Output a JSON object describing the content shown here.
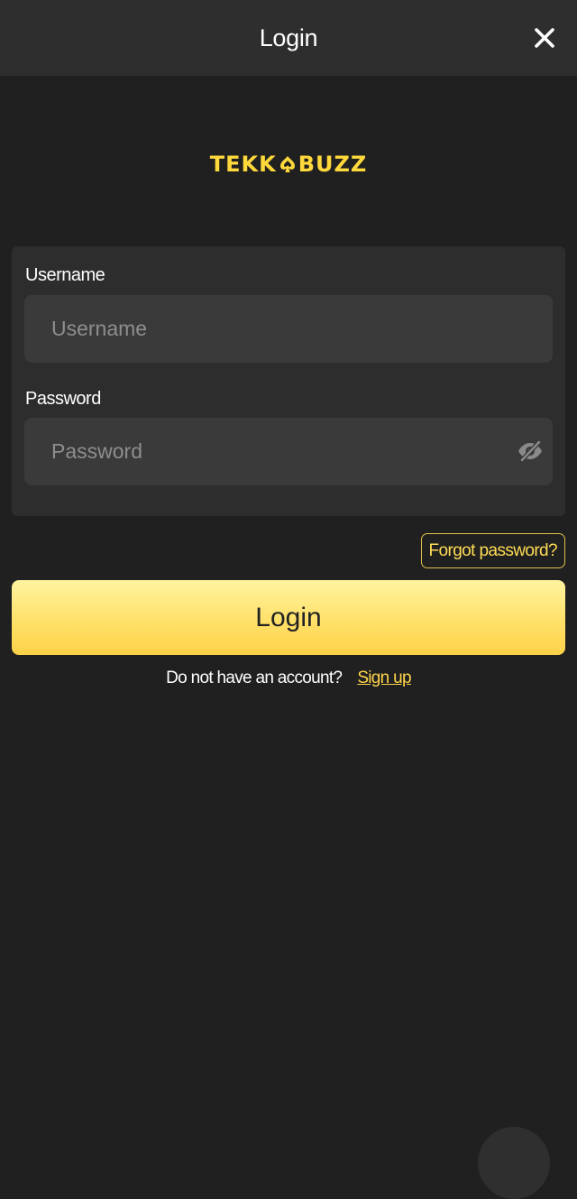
{
  "header": {
    "title": "Login",
    "close_icon": "close-icon"
  },
  "logo": {
    "text_left": "TEKK",
    "text_right": "BUZZ",
    "mark_icon": "spade-icon",
    "color": "#ffd83c"
  },
  "form": {
    "username": {
      "label": "Username",
      "placeholder": "Username",
      "value": ""
    },
    "password": {
      "label": "Password",
      "placeholder": "Password",
      "value": "",
      "toggle_icon": "eye-slash-icon"
    }
  },
  "forgot_password_label": "Forgot password?",
  "login_button_label": "Login",
  "signup": {
    "prompt": "Do not have an account?",
    "link_label": "Sign up"
  },
  "colors": {
    "background": "#202020",
    "header": "#2e2e2e",
    "card": "#2d2d2d",
    "input": "#3a3a3a",
    "accent": "#ffdd55"
  }
}
